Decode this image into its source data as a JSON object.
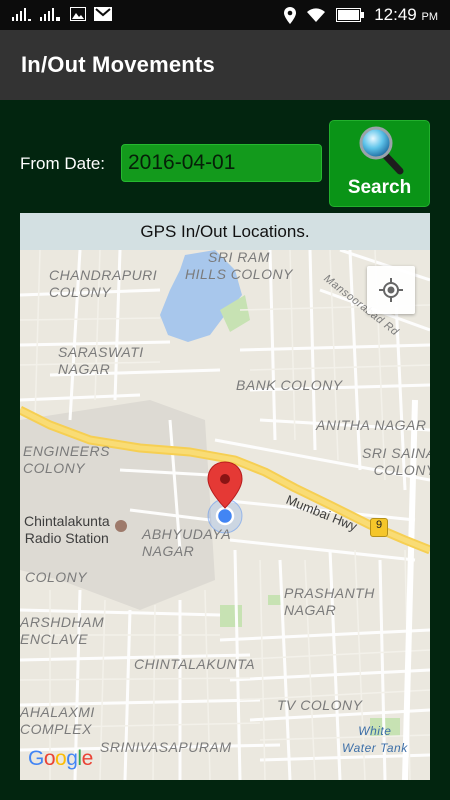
{
  "status_bar": {
    "time": "12:49",
    "meridiem": "PM"
  },
  "app_bar": {
    "title": "In/Out Movements"
  },
  "form": {
    "date_label": "From Date:",
    "date_value": "2016-04-01",
    "search_label": "Search"
  },
  "map": {
    "header": "GPS In/Out Locations.",
    "labels": {
      "chandrapuri": "CHANDRAPURI\nCOLONY",
      "sri_ram": "SRI RAM\nHILLS COLONY",
      "mansoorabad": "Mansoorabad Rd",
      "saraswati": "SARASWATI\nNAGAR",
      "bank": "BANK COLONY",
      "anitha": "ANITHA NAGAR",
      "engineers": "ENGINEERS\nCOLONY",
      "sri_saina": "SRI SAINA\nCOLONY",
      "mumbai": "Mumbai Hwy",
      "highway_no": "9",
      "chintalakunta_radio": "Chintalakunta\nRadio Station",
      "abhyudaya": "ABHYUDAYA\nNAGAR",
      "colony": "COLONY",
      "prashanth": "PRASHANTH\nNAGAR",
      "arshdham": "ARSHDHAM\nENCLAVE",
      "chintalakunta": "CHINTALAKUNTA",
      "tv_colony": "TV COLONY",
      "mahalaxmi": "AHALAXMI\nCOMPLEX",
      "srinivasapuram": "SRINIVASAPURAM",
      "white_water": "White\nWater Tank"
    },
    "attribution": {
      "g1": "G",
      "o1": "o",
      "o2": "o",
      "g2": "g",
      "l": "l",
      "e": "e"
    }
  }
}
